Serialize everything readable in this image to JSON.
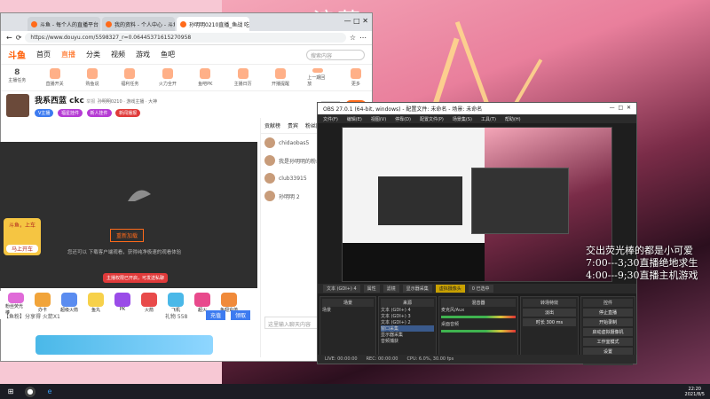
{
  "background": {
    "watermark": "浪荡"
  },
  "browser": {
    "tabs": [
      {
        "label": "斗鱼 - 每个人的直播平台"
      },
      {
        "label": "我的资料 - 个人中心 - 斗鱼"
      },
      {
        "label": "孙明明0210直播_鱼战 吃"
      }
    ],
    "url": "https://www.douyu.com/5598327_r=0.06445371615270958",
    "nav": {
      "logo": "斗鱼",
      "items": [
        "首页",
        "直播",
        "分类",
        "视频",
        "游戏",
        "鱼吧"
      ],
      "search_placeholder": "搜索内容"
    },
    "icons": [
      "主播任务",
      "直播开关",
      "购鱼说",
      "福利任务",
      "火力全开",
      "鱼吧PK",
      "主播日历",
      "开播提醒",
      "上一期回放",
      "更多"
    ],
    "icon_badge": "8",
    "room": {
      "title": "我系西蓝 ckc",
      "tag1": "举报",
      "meta": "孙明明0210 · 游戏主播 · 大神",
      "follow": "关注",
      "count": "471",
      "pills": [
        "V主播",
        "福星挂件",
        "新人挂件",
        "英雄联盟主播",
        "主播",
        "新闻播报",
        "主播"
      ]
    },
    "player": {
      "btn": "重新加载",
      "hint": "您还可以 下载客户端观看，获得纯净极速的观看体验",
      "promo_title": "斗鱼，上车",
      "promo_btn": "马上开车"
    },
    "chat": {
      "tabs": [
        "贡献榜",
        "贵宾",
        "粉丝团"
      ],
      "rows": [
        "chidaobas5",
        "我是孙明明的粉丝",
        "club33915",
        "孙明明 2"
      ],
      "notice": "主播权限已开启，可发送私聊",
      "input_placeholder": "这里输入聊天内容",
      "send": "发送"
    },
    "gifts": [
      "粉丝荧光棒",
      "办卡",
      "超级火箭",
      "鱼丸",
      "PK",
      "火箭",
      "飞机",
      "超火",
      "鱼翅充值"
    ],
    "footer": {
      "left": "【鱼粉】分享得 火箭X1",
      "count": "礼物 558",
      "charge": "充值",
      "btn": "领取"
    }
  },
  "obs": {
    "title": "OBS 27.0.1 (64-bit, windows) - 配置文件: 未命名 - 场景: 未命名",
    "menu": [
      "文件(F)",
      "编辑(E)",
      "视图(V)",
      "停靠(D)",
      "配置文件(P)",
      "场景集(S)",
      "工具(T)",
      "帮助(H)"
    ],
    "sourcebar": [
      "文本 (GDI+) 4",
      "属性",
      "滤镜",
      "显示器采集",
      "虚拟摄像头",
      "0 已选中"
    ],
    "docks": {
      "scenes": {
        "header": "场景",
        "items": [
          "场景"
        ]
      },
      "sources": {
        "header": "来源",
        "items": [
          "文本 (GDI+) 4",
          "文本 (GDI+) 3",
          "文本 (GDI+) 2",
          "窗口采集",
          "显示器采集",
          "音频捕获"
        ]
      },
      "mixer": {
        "header": "混音器",
        "items": [
          "麦克风/Aux",
          "桌面音频"
        ]
      },
      "transitions": {
        "header": "转场特效",
        "items": [
          "淡出",
          "时长 300 ms"
        ]
      },
      "controls": {
        "header": "控件",
        "items": [
          "停止直播",
          "开始录制",
          "启动虚拟摄像机",
          "工作室模式",
          "设置",
          "退出"
        ]
      }
    },
    "status": [
      "LIVE: 00:00:00",
      "REC: 00:00:00",
      "CPU: 6.0%, 30.00 fps"
    ]
  },
  "overlay": [
    "交出荧光棒的都是小可爱",
    "7:00---3;30直播绝地求生",
    "4:00---9;30直播主机游戏"
  ],
  "taskbar": {
    "time": "22:20",
    "date": "2021/8/5"
  }
}
